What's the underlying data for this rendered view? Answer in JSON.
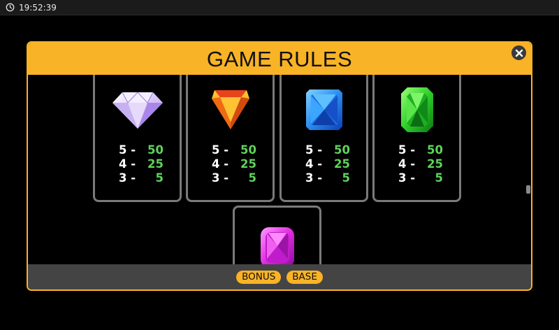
{
  "status_bar": {
    "time": "19:52:39"
  },
  "dialog": {
    "title": "GAME RULES"
  },
  "symbols": [
    {
      "gem": "diamond-icon",
      "color": "#d9c9f5",
      "pays": [
        {
          "count": "5 -",
          "value": "50"
        },
        {
          "count": "4 -",
          "value": "25"
        },
        {
          "count": "3 -",
          "value": "5"
        }
      ]
    },
    {
      "gem": "shield-gem-icon",
      "color": "#f28a12",
      "pays": [
        {
          "count": "5 -",
          "value": "50"
        },
        {
          "count": "4 -",
          "value": "25"
        },
        {
          "count": "3 -",
          "value": "5"
        }
      ]
    },
    {
      "gem": "sapphire-icon",
      "color": "#2a8cf0",
      "pays": [
        {
          "count": "5 -",
          "value": "50"
        },
        {
          "count": "4 -",
          "value": "25"
        },
        {
          "count": "3 -",
          "value": "5"
        }
      ]
    },
    {
      "gem": "emerald-icon",
      "color": "#2fcf2a",
      "pays": [
        {
          "count": "5 -",
          "value": "50"
        },
        {
          "count": "4 -",
          "value": "25"
        },
        {
          "count": "3 -",
          "value": "5"
        }
      ]
    },
    {
      "gem": "amethyst-icon",
      "color": "#e02be0"
    }
  ],
  "footer": {
    "bonus_label": "BONUS",
    "base_label": "BASE"
  },
  "colors": {
    "accent": "#f8b327",
    "payout_value": "#5fd35b",
    "card_border": "#7a7a7a"
  }
}
